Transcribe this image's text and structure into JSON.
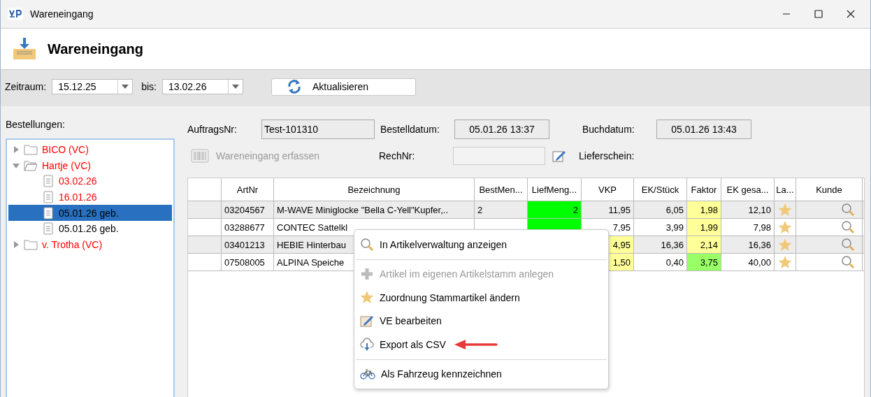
{
  "window": {
    "title": "Wareneingang"
  },
  "header": {
    "title": "Wareneingang"
  },
  "toolbar": {
    "from_label": "Zeitraum:",
    "from_value": "15.12.25",
    "to_label": "bis:",
    "to_value": "13.02.26",
    "refresh_button": "Aktualisieren"
  },
  "sidebar": {
    "label": "Bestellungen:",
    "tree": [
      {
        "label": "BICO (VC)",
        "kind": "folder",
        "expanded": false,
        "selected": false,
        "color": "#ff0000"
      },
      {
        "label": "Hartje (VC)",
        "kind": "folder",
        "expanded": true,
        "selected": false,
        "color": "#ff0000",
        "children": [
          {
            "label": "03.02.26",
            "kind": "order",
            "selected": false,
            "color": "#ff0000"
          },
          {
            "label": "16.01.26",
            "kind": "order",
            "selected": false,
            "color": "#ff0000"
          },
          {
            "label": "05.01.26 geb.",
            "kind": "order",
            "selected": true,
            "color": "#000000"
          },
          {
            "label": "05.01.26 geb.",
            "kind": "order",
            "selected": false,
            "color": "#000000"
          }
        ]
      },
      {
        "label": "v. Trotha (VC)",
        "kind": "folder",
        "expanded": false,
        "selected": false,
        "color": "#ff0000"
      }
    ]
  },
  "form": {
    "order_no_label": "AuftragsNr:",
    "order_no": "Test-101310",
    "order_date_label": "Bestelldatum:",
    "order_date": "05.01.26 13:37",
    "booking_date_label": "Buchdatum:",
    "booking_date": "05.01.26 13:43",
    "receive_button": {
      "label": "Wareneingang erfassen",
      "disabled": true
    },
    "invoice_label": "RechNr:",
    "invoice_disabled": true,
    "delivery_note_label": "Lieferschein:"
  },
  "table": {
    "columns": [
      "",
      "ArtNr",
      "Bezeichnung",
      "BestMen...",
      "LiefMeng...",
      "VKP",
      "EK/Stück",
      "Faktor",
      "EK gesa...",
      "La...",
      "Kunde"
    ],
    "rows": [
      {
        "artnr": "03204567",
        "bezeichnung": "M-WAVE Miniglocke \"Bella C-Yell\"Kupfer,..",
        "bestmenge": "2",
        "liefmenge": {
          "text": "2",
          "color": "#00ff00"
        },
        "vkp": {
          "text": "11,95"
        },
        "ek": "6,05",
        "faktor": {
          "text": "1,98",
          "color": "#ffff99"
        },
        "ek_gesamt": "12,10"
      },
      {
        "artnr": "03288677",
        "bezeichnung": "CONTEC Sattelkl",
        "liefmenge": {
          "color": "#00ff00"
        },
        "vkp": {
          "text": "7,95"
        },
        "ek": "3,99",
        "faktor": {
          "text": "1,99",
          "color": "#ffff99"
        },
        "ek_gesamt": "7,98"
      },
      {
        "artnr": "03401213",
        "bezeichnung": "HEBIE Hinterbau",
        "liefmenge": {},
        "vkp": {
          "text": "4,95",
          "color": "#ffff99"
        },
        "ek": "16,36",
        "faktor": {
          "text": "2,14",
          "color": "#ffff99"
        },
        "ek_gesamt": "16,36"
      },
      {
        "artnr": "07508005",
        "bezeichnung": "ALPINA Speiche",
        "liefmenge": {},
        "vkp": {
          "text": "1,50",
          "color": "#ffff99"
        },
        "ek": "0,40",
        "faktor": {
          "text": "3,75",
          "color": "#99ff66"
        },
        "ek_gesamt": "40,00"
      }
    ]
  },
  "context_menu": [
    {
      "kind": "search",
      "label": "In Artikelverwaltung anzeigen",
      "disabled": false
    },
    {
      "kind": "separator"
    },
    {
      "kind": "add",
      "label": "Artikel im eigenen Artikelstamm anlegen",
      "disabled": true
    },
    {
      "kind": "star",
      "label": "Zuordnung Stammartikel ändern",
      "disabled": false
    },
    {
      "kind": "edit",
      "label": "VE bearbeiten",
      "disabled": false
    },
    {
      "kind": "export",
      "label": "Export als CSV",
      "disabled": false,
      "highlighted": true
    },
    {
      "kind": "separator"
    },
    {
      "kind": "vehicle",
      "label": "Als Fahrzeug kennzeichnen",
      "disabled": false
    }
  ]
}
